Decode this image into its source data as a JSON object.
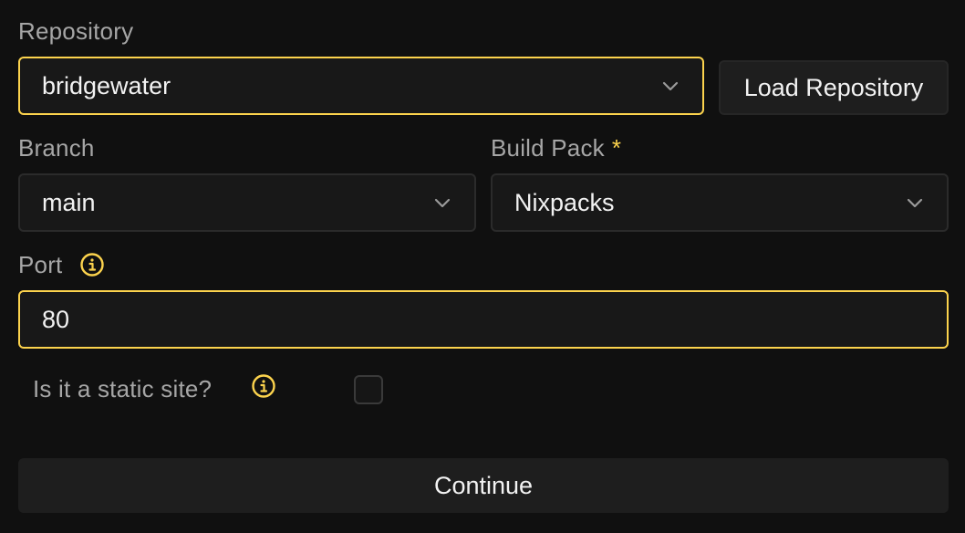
{
  "repository": {
    "label": "Repository",
    "value": "bridgewater",
    "load_button": "Load Repository"
  },
  "branch": {
    "label": "Branch",
    "value": "main"
  },
  "build_pack": {
    "label": "Build Pack",
    "required_mark": "*",
    "value": "Nixpacks"
  },
  "port": {
    "label": "Port",
    "value": "80",
    "info_icon": "info-icon"
  },
  "static_site": {
    "label": "Is it a static site?",
    "checked": false,
    "info_icon": "info-icon"
  },
  "continue_button": "Continue",
  "colors": {
    "accent": "#fcd34d",
    "background": "#101010",
    "field_bg": "#181818"
  }
}
